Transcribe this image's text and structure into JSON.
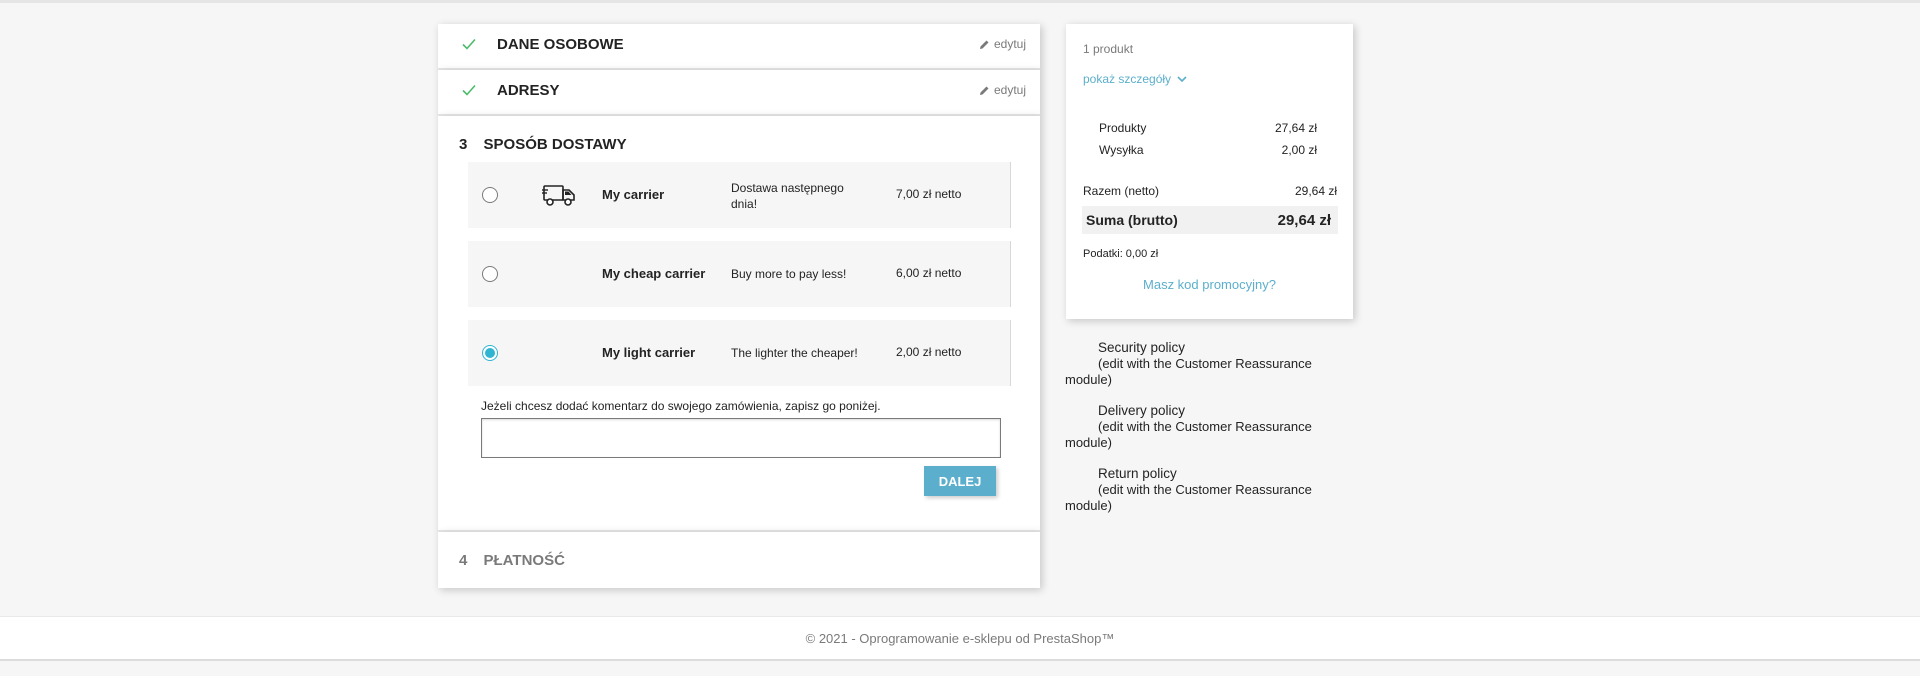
{
  "checkout": {
    "steps_done": [
      {
        "title": "Dane osobowe",
        "edit_label": "edytuj"
      },
      {
        "title": "Adresy",
        "edit_label": "edytuj"
      }
    ],
    "current_step": {
      "number": "3",
      "title": "Sposób dostawy",
      "carriers": [
        {
          "name": "My carrier",
          "delay": "Dostawa następnego dnia!",
          "price": "7,00 zł netto",
          "selected": false,
          "icon": "truck-icon"
        },
        {
          "name": "My cheap carrier",
          "delay": "Buy more to pay less!",
          "price": "6,00 zł netto",
          "selected": false
        },
        {
          "name": "My light carrier",
          "delay": "The lighter the cheaper!",
          "price": "2,00 zł netto",
          "selected": true
        }
      ],
      "comment_label": "Jeżeli chcesz dodać komentarz do swojego zamówienia, zapisz go poniżej.",
      "comment_value": "",
      "continue_label": "Dalej"
    },
    "next_step": {
      "number": "4",
      "title": "Płatność"
    }
  },
  "summary": {
    "product_count": "1 produkt",
    "show_details": "pokaż szczegóły",
    "products_label": "Produkty",
    "products_value": "27,64 zł",
    "shipping_label": "Wysyłka",
    "shipping_value": "2,00 zł",
    "net_label": "Razem (netto)",
    "net_value": "29,64 zł",
    "total_label": "Suma (brutto)",
    "total_value": "29,64 zł",
    "taxes": "Podatki: 0,00 zł",
    "promo_link": "Masz kod promocyjny?"
  },
  "reassurance": [
    {
      "title": "Security policy",
      "note": "(edit with the Customer Reassurance module)"
    },
    {
      "title": "Delivery policy",
      "note": "(edit with the Customer Reassurance module)"
    },
    {
      "title": "Return policy",
      "note": "(edit with the Customer Reassurance module)"
    }
  ],
  "footer": {
    "text": "© 2021 - Oprogramowanie e-sklepu od PrestaShop™"
  },
  "colors": {
    "accent": "#5cafcc",
    "check": "#4cbb6c",
    "radio_selected": "#2fb5d2"
  }
}
